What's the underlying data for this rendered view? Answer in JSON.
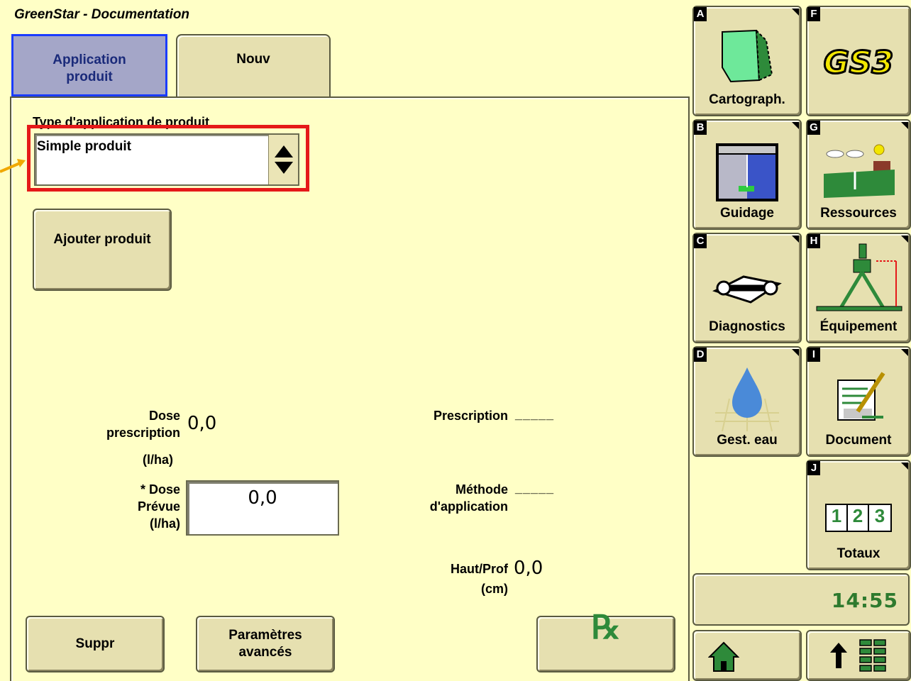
{
  "app": {
    "title": "GreenStar - Documentation"
  },
  "tabs": [
    {
      "label_line1": "Application",
      "label_line2": "produit",
      "active": true
    },
    {
      "label": "Nouv",
      "active": false
    }
  ],
  "product_type": {
    "label": "Type d'application de produit",
    "selected": "Simple produit"
  },
  "buttons": {
    "add_product": "Ajouter produit",
    "delete": "Suppr",
    "advanced_line1": "Paramètres",
    "advanced_line2": "avancés",
    "rx_symbol": "℞"
  },
  "fields": {
    "dose_prescription_l1": "Dose",
    "dose_prescription_l2": "prescription",
    "dose_prescription_unit": "(l/ha)",
    "dose_prescription_value": "0,0",
    "dose_prevue_l1": "* Dose",
    "dose_prevue_l2": "Prévue",
    "dose_prevue_unit": "(l/ha)",
    "dose_prevue_value": "0,0",
    "prescription_label": "Prescription",
    "prescription_value": "_____",
    "methode_l1": "Méthode",
    "methode_l2": "d'application",
    "methode_value": "_____",
    "haut_prof_label": "Haut/Prof",
    "haut_prof_unit": "(cm)",
    "haut_prof_value": "0,0"
  },
  "side_menu": [
    {
      "letter": "A",
      "label": "Cartograph.",
      "icon": "field-map-icon"
    },
    {
      "letter": "F",
      "label": "GS3",
      "icon": "gs3-logo-icon"
    },
    {
      "letter": "B",
      "label": "Guidage",
      "icon": "guidance-icon"
    },
    {
      "letter": "G",
      "label": "Ressources",
      "icon": "farm-resources-icon"
    },
    {
      "letter": "C",
      "label": "Diagnostics",
      "icon": "wrench-book-icon"
    },
    {
      "letter": "H",
      "label": "Équipement",
      "icon": "implement-icon"
    },
    {
      "letter": "D",
      "label": "Gest. eau",
      "icon": "water-drop-icon"
    },
    {
      "letter": "I",
      "label": "Document",
      "icon": "document-pen-icon"
    },
    {
      "letter": "J",
      "label": "Totaux",
      "icon": "totals-icon",
      "digits": [
        "1",
        "2",
        "3"
      ]
    }
  ],
  "clock": "14:55",
  "colors": {
    "background": "#ffffc6",
    "button": "#e6e0b0",
    "active_tab": "#a4a6c8",
    "highlight": "#e51919",
    "clock_text": "#2e7a2e",
    "john_deere_green": "#2e8a3a"
  }
}
